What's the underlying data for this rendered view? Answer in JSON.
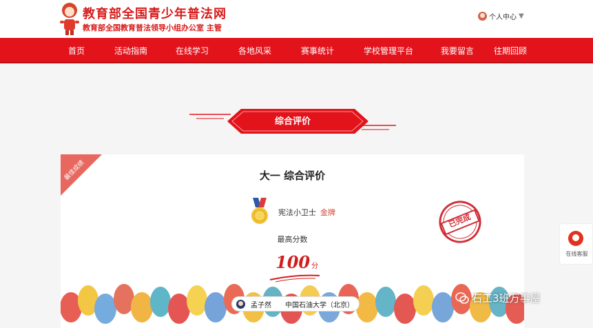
{
  "header": {
    "title": "教育部全国青少年普法网",
    "subtitle": "教育部全国教育普法领导小组办公室 主管",
    "personal_center": "个人中心"
  },
  "nav": {
    "items": [
      "首页",
      "活动指南",
      "在线学习",
      "各地风采",
      "赛事统计",
      "学校管理平台",
      "我要留言",
      "往期回顾"
    ]
  },
  "section": {
    "banner_title": "综合评价"
  },
  "card": {
    "ribbon": "最佳成绩",
    "title": "大一 综合评价",
    "award_name": "宪法小卫士",
    "award_level": "金牌",
    "stamp": "已完成",
    "score_label": "最高分数",
    "score_value": "100",
    "score_unit": "分"
  },
  "user": {
    "name": "孟子然",
    "school": "中国石油大学（北京）"
  },
  "sidebar": {
    "service_label": "在线客服"
  },
  "watermark": {
    "text": "石工3班万事屋"
  },
  "colors": {
    "brand_red": "#e3131b",
    "accent_red": "#d21d1d"
  }
}
